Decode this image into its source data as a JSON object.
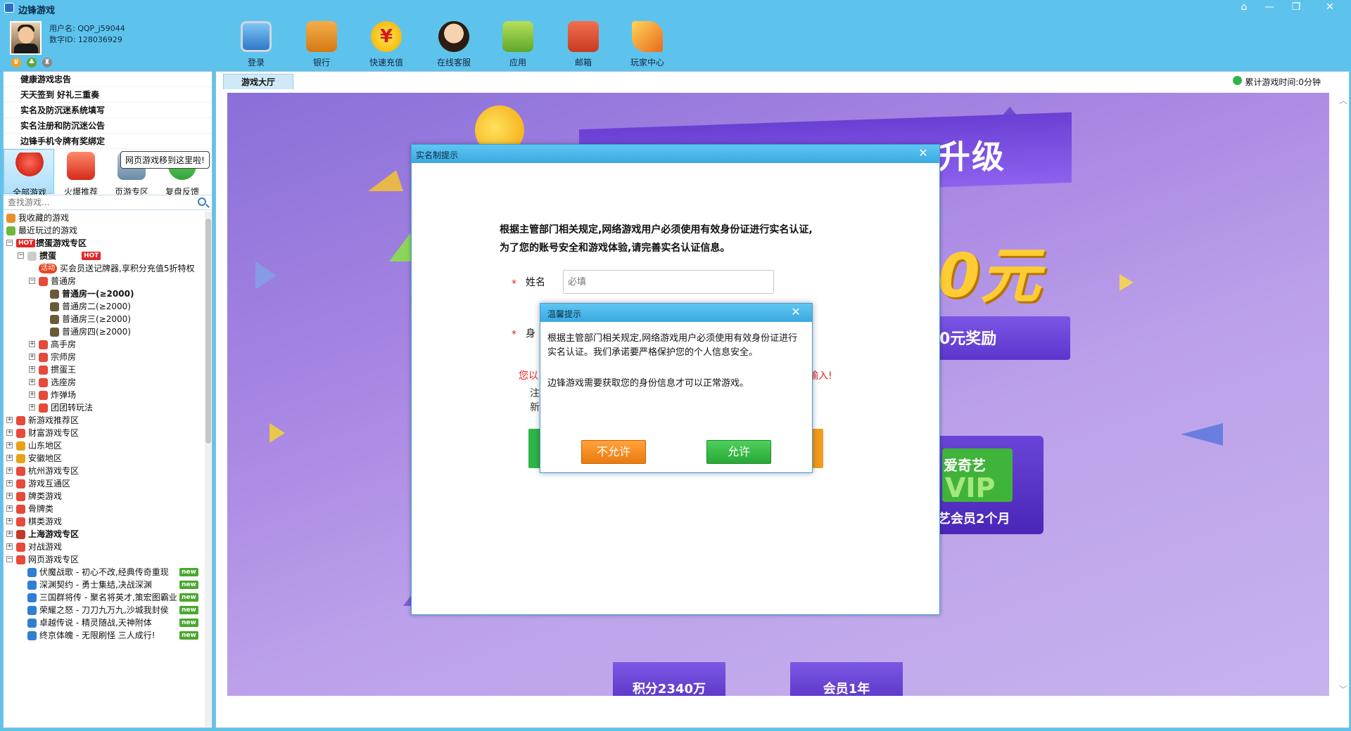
{
  "window": {
    "title": "边锋游戏",
    "controls": [
      "home-icon",
      "minimize-icon",
      "restore-icon",
      "close-icon"
    ]
  },
  "user": {
    "username_line": "用户名: QQP_j59044",
    "digit_id_line": "数字ID: 128036929"
  },
  "toolbar": {
    "items": [
      {
        "label": "登录",
        "icon": "monitor-icon",
        "color": "#3b8fd6"
      },
      {
        "label": "银行",
        "icon": "wallet-icon",
        "color": "#e28a1e"
      },
      {
        "label": "快速充值",
        "icon": "yuan-coin-icon",
        "color": "#f3c51b"
      },
      {
        "label": "在线客服",
        "icon": "support-agent-icon",
        "color": "#f0c6a0"
      },
      {
        "label": "应用",
        "icon": "gift-box-icon",
        "color": "#8bc83a"
      },
      {
        "label": "邮箱",
        "icon": "mail-icon",
        "color": "#e1533a"
      },
      {
        "label": "玩家中心",
        "icon": "party-horn-icon",
        "color": "#f3a02a"
      }
    ]
  },
  "notices": [
    "健康游戏忠告",
    "天天签到 好礼三重奏",
    "实名及防沉迷系统填写",
    "实名注册和防沉迷公告",
    "边锋手机令牌有奖绑定"
  ],
  "categories": [
    {
      "label": "全部游戏",
      "icon": "map-pin-icon",
      "color": "#e53b2c"
    },
    {
      "label": "火爆推荐",
      "icon": "gift-icon",
      "color": "#e84a3a"
    },
    {
      "label": "页游专区",
      "icon": "gamepad-icon",
      "color": "#6a8aa8"
    },
    {
      "label": "复盘反馈",
      "icon": "chat-icon",
      "color": "#3bb54a"
    }
  ],
  "tooltip": "网页游戏移到这里啦!",
  "search": {
    "placeholder": "查找游戏..."
  },
  "tree": [
    {
      "label": "我收藏的游戏",
      "indent": 0,
      "icon_color": "#e8902a",
      "exp": ""
    },
    {
      "label": "最近玩过的游戏",
      "indent": 0,
      "icon_color": "#6fb83a",
      "exp": ""
    },
    {
      "label": "掼蛋游戏专区",
      "indent": 0,
      "icon_color": "#e52424",
      "exp": "−",
      "bold": true,
      "hot_prefix": "HOT"
    },
    {
      "label": "掼蛋",
      "indent": 1,
      "icon_color": "#cccccc",
      "exp": "−",
      "bold": true,
      "hot": "HOT"
    },
    {
      "label": "买会员送记牌器,享积分充值5折特权",
      "indent": 2,
      "icon_color": "",
      "exp": "",
      "act": "活动"
    },
    {
      "label": "普通房",
      "indent": 2,
      "icon_color": "#e54a3a",
      "exp": "−"
    },
    {
      "label": "普通房一(≥2000)",
      "indent": 3,
      "icon_color": "#6b5a3a",
      "exp": "",
      "bold": true
    },
    {
      "label": "普通房二(≥2000)",
      "indent": 3,
      "icon_color": "#6b5a3a",
      "exp": ""
    },
    {
      "label": "普通房三(≥2000)",
      "indent": 3,
      "icon_color": "#6b5a3a",
      "exp": ""
    },
    {
      "label": "普通房四(≥2000)",
      "indent": 3,
      "icon_color": "#6b5a3a",
      "exp": ""
    },
    {
      "label": "高手房",
      "indent": 2,
      "icon_color": "#e54a3a",
      "exp": "+"
    },
    {
      "label": "宗师房",
      "indent": 2,
      "icon_color": "#e54a3a",
      "exp": "+"
    },
    {
      "label": "掼蛋王",
      "indent": 2,
      "icon_color": "#e54a3a",
      "exp": "+"
    },
    {
      "label": "选座房",
      "indent": 2,
      "icon_color": "#e54a3a",
      "exp": "+"
    },
    {
      "label": "炸弹场",
      "indent": 2,
      "icon_color": "#e54a3a",
      "exp": "+"
    },
    {
      "label": "团团转玩法",
      "indent": 2,
      "icon_color": "#e54a3a",
      "exp": "+"
    },
    {
      "label": "新游戏推荐区",
      "indent": 0,
      "icon_color": "#e54a3a",
      "exp": "+"
    },
    {
      "label": "财富游戏专区",
      "indent": 0,
      "icon_color": "#e54a3a",
      "exp": "+"
    },
    {
      "label": "山东地区",
      "indent": 0,
      "icon_color": "#e8a21a",
      "exp": "+"
    },
    {
      "label": "安徽地区",
      "indent": 0,
      "icon_color": "#e8a21a",
      "exp": "+"
    },
    {
      "label": "杭州游戏专区",
      "indent": 0,
      "icon_color": "#e54a3a",
      "exp": "+"
    },
    {
      "label": "游戏互通区",
      "indent": 0,
      "icon_color": "#e54a3a",
      "exp": "+"
    },
    {
      "label": "牌类游戏",
      "indent": 0,
      "icon_color": "#e54a3a",
      "exp": "+"
    },
    {
      "label": "骨牌类",
      "indent": 0,
      "icon_color": "#e54a3a",
      "exp": "+"
    },
    {
      "label": "棋类游戏",
      "indent": 0,
      "icon_color": "#e54a3a",
      "exp": "+"
    },
    {
      "label": "上海游戏专区",
      "indent": 0,
      "icon_color": "#c0392b",
      "exp": "+",
      "bold": true
    },
    {
      "label": "对战游戏",
      "indent": 0,
      "icon_color": "#e54a3a",
      "exp": "+"
    },
    {
      "label": "网页游戏专区",
      "indent": 0,
      "icon_color": "#e54a3a",
      "exp": "−"
    },
    {
      "label": "伏魔战歌 - 初心不改,经典传奇重现",
      "indent": 1,
      "icon_color": "#2f7fd4",
      "exp": "",
      "new": "new"
    },
    {
      "label": "深渊契约 - 勇士集结,决战深渊",
      "indent": 1,
      "icon_color": "#2f7fd4",
      "exp": "",
      "new": "new"
    },
    {
      "label": "三国群将传 - 聚名将英才,策宏图霸业",
      "indent": 1,
      "icon_color": "#2f7fd4",
      "exp": "",
      "new": "new"
    },
    {
      "label": "荣耀之怒 - 刀刀九万九,沙城我封侯",
      "indent": 1,
      "icon_color": "#2f7fd4",
      "exp": "",
      "new": "new"
    },
    {
      "label": "卓越传说 - 精灵随战,天神附体",
      "indent": 1,
      "icon_color": "#2f7fd4",
      "exp": "",
      "new": "new"
    },
    {
      "label": "终京体魄 - 无限刷怪 三人成行!",
      "indent": 1,
      "icon_color": "#2f7fd4",
      "exp": "",
      "new": "new"
    }
  ],
  "main": {
    "tab": "游戏大厅",
    "playtime": "累计游戏时间:0分钟"
  },
  "banner": {
    "headline": "升级",
    "money": "0元",
    "reward": "0元奖励",
    "vip_brand": "爱奇艺",
    "vip_word": "VIP",
    "vip_caption": "艺会员2个月",
    "prizes": [
      "积分2340万",
      "会员1年"
    ]
  },
  "dialog_realname": {
    "title": "实名制提示",
    "message_line1": "根据主管部门相关规定,网络游戏用户必须使用有效身份证进行实名认证,",
    "message_line2": "为了您的账号安全和游戏体验,请完善实名认证信息。",
    "name_label": "姓名",
    "name_placeholder": "必填",
    "id_label_partial": "身",
    "required_mark": "*",
    "warn_left": "您以",
    "warn_right": "输入!",
    "note_left_1": "注",
    "note_left_2": "新",
    "note_right": ","
  },
  "dialog_warm": {
    "title": "温馨提示",
    "body1": "根据主管部门相关规定,网络游戏用户必须使用有效身份证进行实名认证。我们承诺要严格保护您的个人信息安全。",
    "body2": "边锋游戏需要获取您的身份信息才可以正常游戏。",
    "deny": "不允许",
    "allow": "允许"
  }
}
